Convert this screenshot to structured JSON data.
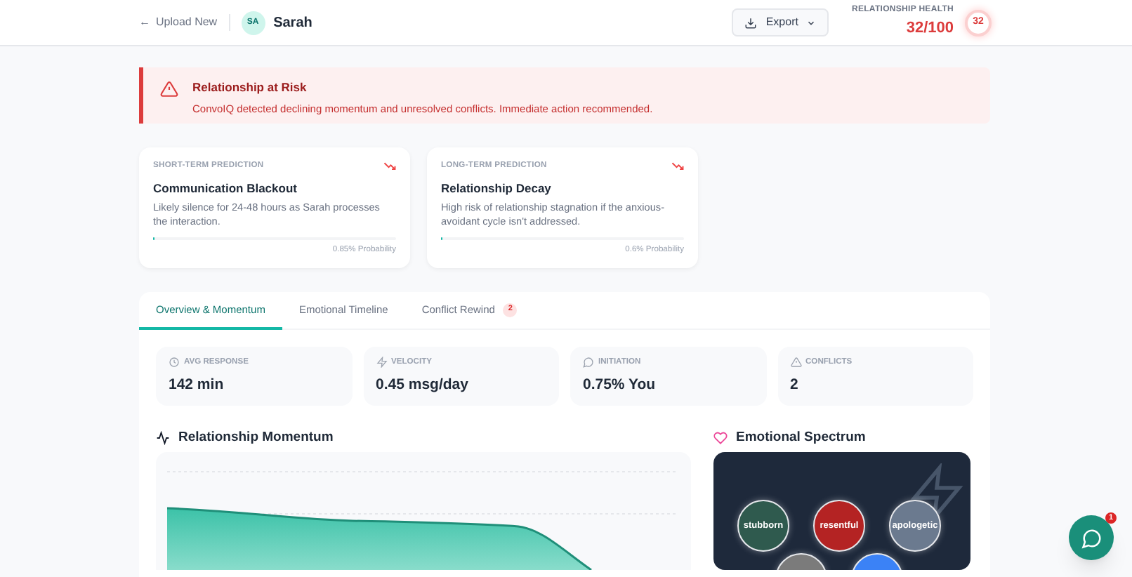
{
  "header": {
    "back_link": "Upload New",
    "back_arrow": "←",
    "contact": {
      "initials": "SA",
      "name": "Sarah"
    },
    "export_button": "Export",
    "health": {
      "label": "RELATIONSHIP HEALTH",
      "score": "32/100",
      "badge": "32"
    }
  },
  "alert": {
    "title": "Relationship at Risk",
    "message": "ConvoIQ detected declining momentum and unresolved conflicts. Immediate action recommended."
  },
  "predictions": [
    {
      "label": "SHORT-TERM PREDICTION",
      "title": "Communication Blackout",
      "text": "Likely silence for 24-48 hours as Sarah processes the interaction.",
      "level": 0.0085,
      "probability": "0.85% Probability"
    },
    {
      "label": "LONG-TERM PREDICTION",
      "title": "Relationship Decay",
      "text": "High risk of relationship stagnation if the anxious-avoidant cycle isn't addressed.",
      "level": 0.006,
      "probability": "0.6% Probability"
    }
  ],
  "tabs": [
    {
      "label": "Overview & Momentum",
      "selected": true
    },
    {
      "label": "Emotional Timeline",
      "selected": false
    },
    {
      "label": "Conflict Rewind",
      "selected": false,
      "badge": "2"
    }
  ],
  "stats": [
    {
      "kind": "clock",
      "label": "AVG RESPONSE",
      "value": "142 min"
    },
    {
      "kind": "bolt",
      "label": "VELOCITY",
      "value": "0.45 msg/day"
    },
    {
      "kind": "chat",
      "label": "INITIATION",
      "value": "0.75% You"
    },
    {
      "kind": "warning",
      "label": "CONFLICTS",
      "value": "2"
    }
  ],
  "momentum": {
    "title": "Relationship Momentum"
  },
  "spectrum": {
    "title": "Emotional Spectrum",
    "bubbles": [
      {
        "label": "stubborn",
        "color": "#2f5a4e"
      },
      {
        "label": "resentful",
        "color": "#b42323"
      },
      {
        "label": "apologetic",
        "color": "#6b7a8f"
      },
      {
        "color": "#7b7b7b"
      },
      {
        "color": "#3b82f6"
      }
    ]
  },
  "chat_button": {
    "badge": "1"
  }
}
